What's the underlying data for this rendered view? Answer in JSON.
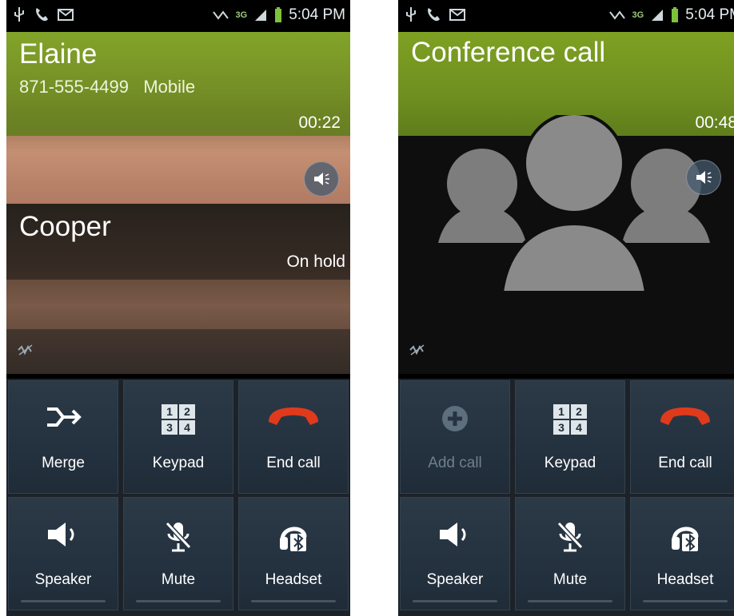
{
  "status_bar": {
    "time": "5:04 PM",
    "network": "3G",
    "icons": [
      "usb-icon",
      "phone-icon",
      "message-icon",
      "mute-notification-icon",
      "network-3g-icon",
      "signal-icon",
      "battery-icon"
    ]
  },
  "screens": [
    {
      "active_call": {
        "name": "Elaine",
        "number": "871-555-4499",
        "type": "Mobile",
        "duration": "00:22"
      },
      "held_call": {
        "name": "Cooper",
        "status": "On hold"
      },
      "buttons": {
        "merge": "Merge",
        "keypad": "Keypad",
        "end_call": "End call",
        "speaker": "Speaker",
        "mute": "Mute",
        "headset": "Headset"
      }
    },
    {
      "active_call": {
        "name": "Conference call",
        "duration": "00:48"
      },
      "buttons": {
        "add_call": "Add call",
        "keypad": "Keypad",
        "end_call": "End call",
        "speaker": "Speaker",
        "mute": "Mute",
        "headset": "Headset"
      }
    }
  ],
  "keypad_digits": [
    "1",
    "2",
    "3",
    "4"
  ],
  "colors": {
    "accent_green": "#7ea022",
    "end_call_red": "#e03a1c",
    "button_bg": "#263441"
  }
}
